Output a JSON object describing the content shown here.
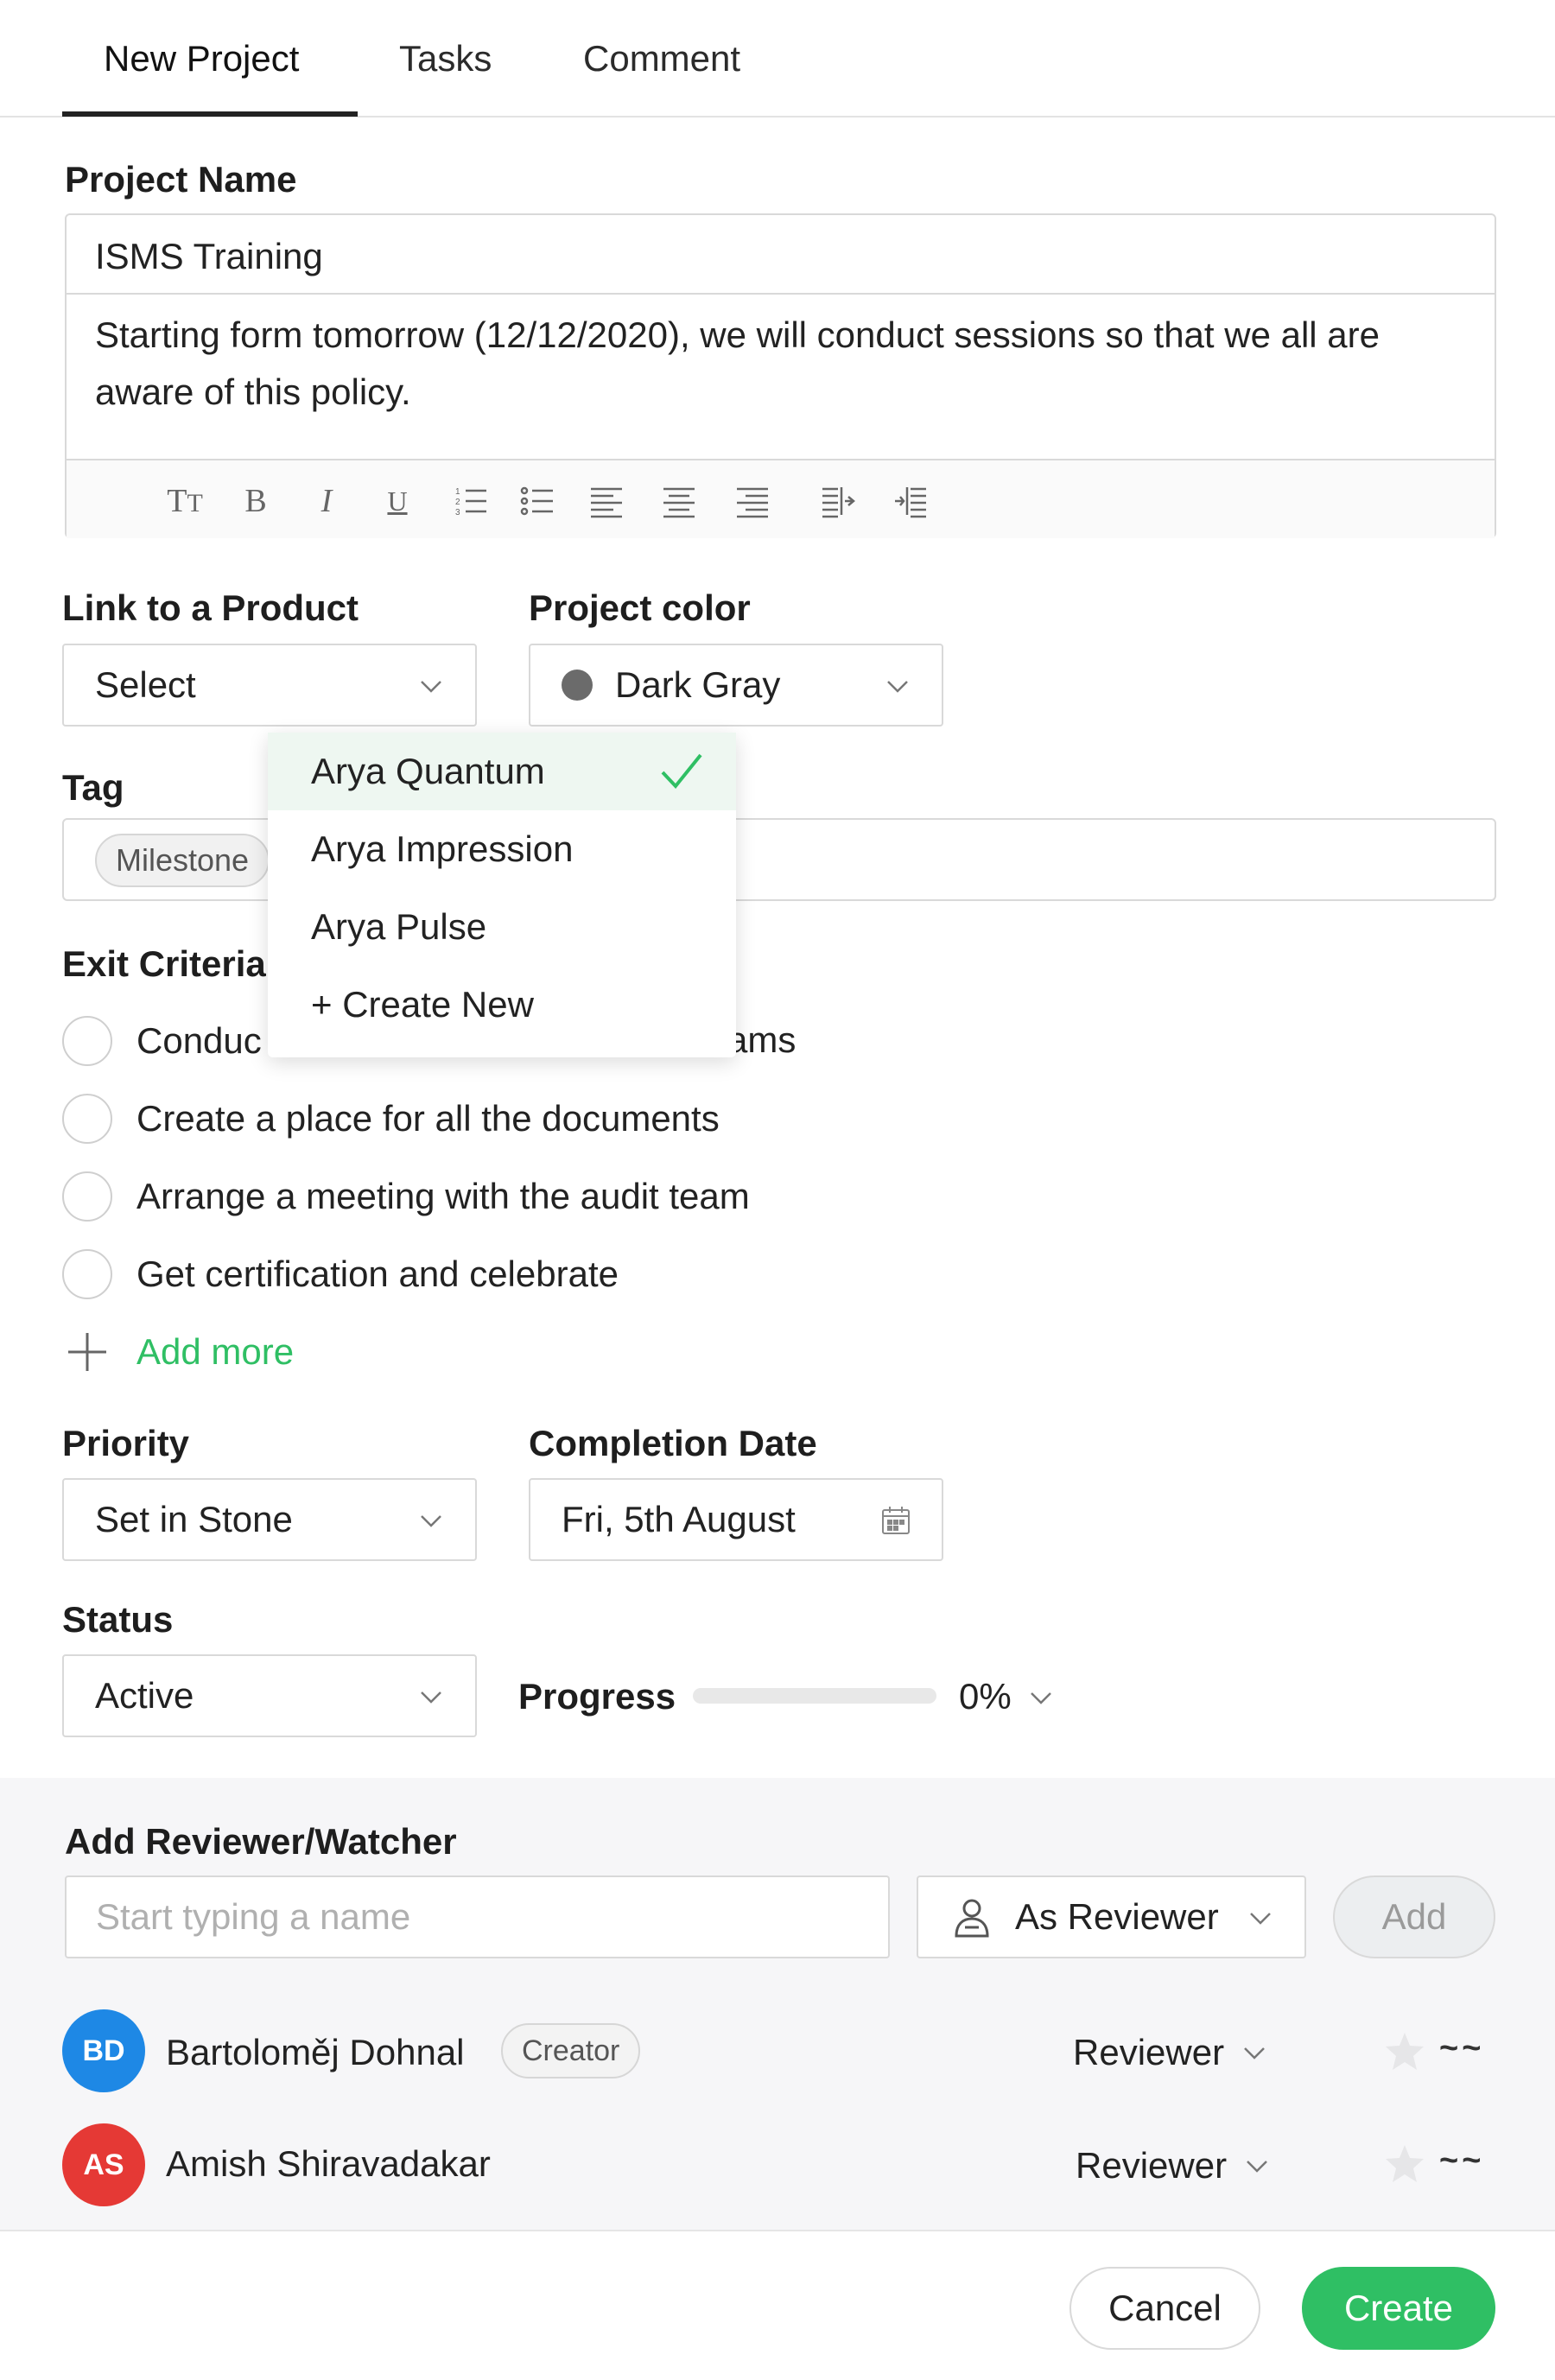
{
  "tabs": [
    {
      "label": "New Project",
      "active": true
    },
    {
      "label": "Tasks",
      "active": false
    },
    {
      "label": "Comment",
      "active": false
    }
  ],
  "project": {
    "label": "Project Name",
    "name_value": "ISMS Training",
    "description": "Starting form tomorrow (12/12/2020), we will conduct sessions so that we all are aware of this policy."
  },
  "toolbar_icons": [
    "text-size-icon",
    "bold-icon",
    "italic-icon",
    "underline-icon",
    "ordered-list-icon",
    "bullet-list-icon",
    "align-left-icon",
    "align-center-icon",
    "align-right-icon",
    "indent-icon",
    "outdent-icon"
  ],
  "link_product": {
    "label": "Link to a Product",
    "value": "Select"
  },
  "project_color": {
    "label": "Project color",
    "value": "Dark Gray",
    "color": "#6b6b6b"
  },
  "product_dropdown": {
    "items": [
      "Arya Quantum",
      "Arya Impression",
      "Arya Pulse",
      "+ Create New"
    ],
    "selected": "Arya Quantum"
  },
  "tag": {
    "label": "Tag",
    "chips": [
      "Milestone"
    ]
  },
  "exit_criteria": {
    "label": "Exit Criteria",
    "items": [
      {
        "visible_left": "Conduc",
        "visible_right": "ams"
      },
      {
        "text": "Create a place for all the documents"
      },
      {
        "text": "Arrange a meeting with the audit team"
      },
      {
        "text": "Get certification and celebrate"
      }
    ],
    "add_more": "Add more"
  },
  "priority": {
    "label": "Priority",
    "value": "Set in Stone"
  },
  "completion_date": {
    "label": "Completion Date",
    "value": "Fri, 5th August"
  },
  "status": {
    "label": "Status",
    "value": "Active"
  },
  "progress": {
    "label": "Progress",
    "value": 0,
    "display": "0%"
  },
  "reviewers": {
    "label": "Add Reviewer/Watcher",
    "placeholder": "Start typing a name",
    "role_select": "As Reviewer",
    "add_button": "Add",
    "people": [
      {
        "initials": "BD",
        "name": "Bartoloměj Dohnal",
        "badge": "Creator",
        "role": "Reviewer",
        "avatar_color": "#1e88e5",
        "suffix": "~~"
      },
      {
        "initials": "AS",
        "name": "Amish Shiravadakar",
        "badge": "",
        "role": "Reviewer",
        "avatar_color": "#e53935",
        "suffix": "~~"
      }
    ]
  },
  "footer": {
    "cancel": "Cancel",
    "create": "Create"
  },
  "colors": {
    "accent_green": "#2fbf64",
    "border": "#d9d9d9"
  }
}
